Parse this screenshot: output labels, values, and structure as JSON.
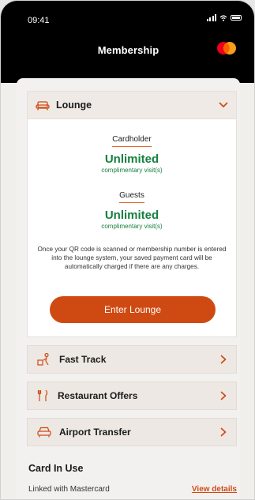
{
  "status": {
    "time": "09:41"
  },
  "header": {
    "title": "Membership"
  },
  "lounge": {
    "label": "Lounge",
    "cardholder_label": "Cardholder",
    "cardholder_value": "Unlimited",
    "cardholder_sub": "complimentary visit(s)",
    "guests_label": "Guests",
    "guests_value": "Unlimited",
    "guests_sub": "complimentary visit(s)",
    "note": "Once your QR code is scanned or membership number is entered into the lounge system, your saved payment card will be automatically charged if there are any charges.",
    "button": "Enter Lounge"
  },
  "rows": [
    {
      "label": "Fast Track",
      "icon": "fast-track-icon"
    },
    {
      "label": "Restaurant Offers",
      "icon": "restaurant-icon"
    },
    {
      "label": "Airport Transfer",
      "icon": "car-icon"
    }
  ],
  "card_in_use": {
    "title": "Card In Use",
    "linked": "Linked with Mastercard",
    "view": "View details"
  },
  "colors": {
    "accent": "#cf4a12",
    "green": "#15803d",
    "header_bg": "#000000"
  }
}
